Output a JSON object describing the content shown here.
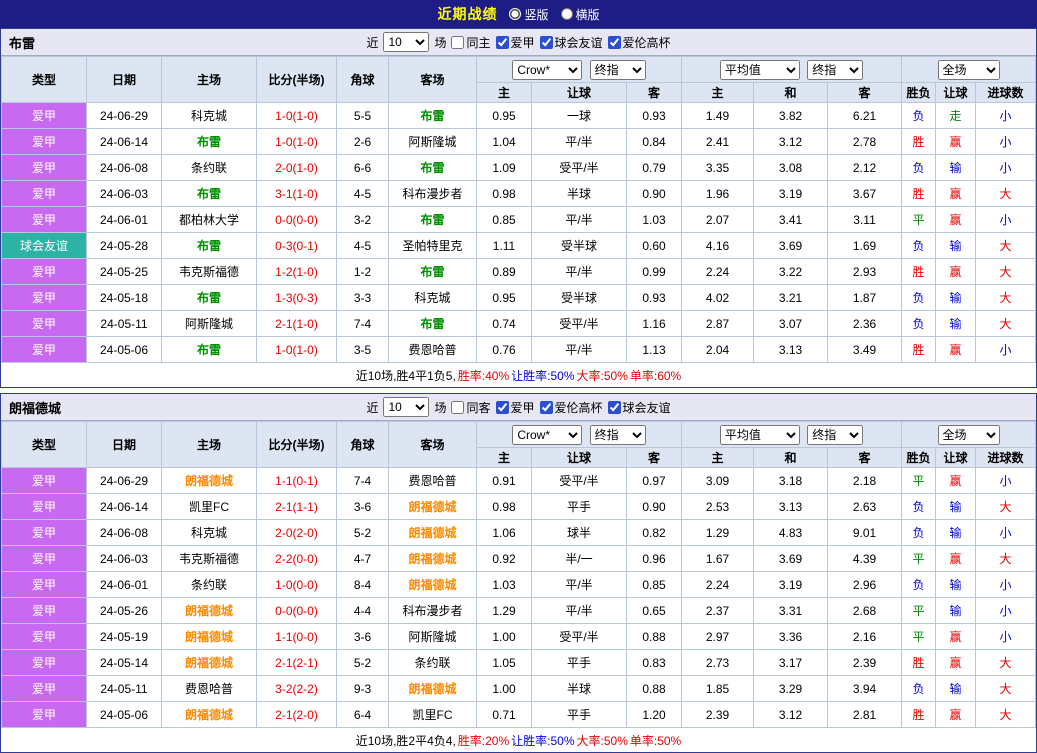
{
  "top_bar": {
    "title": "近期战绩",
    "radios": [
      {
        "label": "竖版",
        "checked": true
      },
      {
        "label": "横版",
        "checked": false
      }
    ]
  },
  "columns": [
    "类型",
    "日期",
    "主场",
    "比分(半场)",
    "角球",
    "客场",
    "主",
    "让球",
    "客",
    "主",
    "和",
    "客",
    "胜负",
    "让球",
    "进球数"
  ],
  "sections": [
    {
      "team": "布雷",
      "hl": "hl-green",
      "near_label": "近",
      "count": "10",
      "games_label": "场",
      "checkboxes": [
        {
          "label": "同主",
          "checked": false
        },
        {
          "label": "爱甲",
          "checked": true
        },
        {
          "label": "球会友谊",
          "checked": true
        },
        {
          "label": "爱伦高杯",
          "checked": true
        }
      ],
      "selects": {
        "company": "Crow*",
        "company_stage": "终指",
        "avg": "平均值",
        "avg_stage": "终指",
        "scope": "全场"
      },
      "rows": [
        {
          "type": "爱甲",
          "type_c": "purple",
          "date": "24-06-29",
          "home": "科克城",
          "home_hl": false,
          "score": "1-0(1-0)",
          "corner": "5-5",
          "away": "布雷",
          "away_hl": true,
          "o_h": "0.95",
          "line": "一球",
          "o_a": "0.93",
          "e_h": "1.49",
          "e_d": "3.82",
          "e_a": "6.21",
          "res": "负",
          "res_c": "blue",
          "hres": "走",
          "hres_c": "green",
          "gres": "小",
          "gres_c": "blue"
        },
        {
          "type": "爱甲",
          "type_c": "purple",
          "date": "24-06-14",
          "home": "布雷",
          "home_hl": true,
          "score": "1-0(1-0)",
          "corner": "2-6",
          "away": "阿斯隆城",
          "away_hl": false,
          "o_h": "1.04",
          "line": "平/半",
          "o_a": "0.84",
          "e_h": "2.41",
          "e_d": "3.12",
          "e_a": "2.78",
          "res": "胜",
          "res_c": "red",
          "hres": "赢",
          "hres_c": "red",
          "gres": "小",
          "gres_c": "blue"
        },
        {
          "type": "爱甲",
          "type_c": "purple",
          "date": "24-06-08",
          "home": "条约联",
          "home_hl": false,
          "score": "2-0(1-0)",
          "corner": "6-6",
          "away": "布雷",
          "away_hl": true,
          "o_h": "1.09",
          "line": "受平/半",
          "o_a": "0.79",
          "e_h": "3.35",
          "e_d": "3.08",
          "e_a": "2.12",
          "res": "负",
          "res_c": "blue",
          "hres": "输",
          "hres_c": "blue",
          "gres": "小",
          "gres_c": "blue"
        },
        {
          "type": "爱甲",
          "type_c": "purple",
          "date": "24-06-03",
          "home": "布雷",
          "home_hl": true,
          "score": "3-1(1-0)",
          "corner": "4-5",
          "away": "科布漫步者",
          "away_hl": false,
          "o_h": "0.98",
          "line": "半球",
          "o_a": "0.90",
          "e_h": "1.96",
          "e_d": "3.19",
          "e_a": "3.67",
          "res": "胜",
          "res_c": "red",
          "hres": "赢",
          "hres_c": "red",
          "gres": "大",
          "gres_c": "red"
        },
        {
          "type": "爱甲",
          "type_c": "purple",
          "date": "24-06-01",
          "home": "都柏林大学",
          "home_hl": false,
          "score": "0-0(0-0)",
          "corner": "3-2",
          "away": "布雷",
          "away_hl": true,
          "o_h": "0.85",
          "line": "平/半",
          "o_a": "1.03",
          "e_h": "2.07",
          "e_d": "3.41",
          "e_a": "3.11",
          "res": "平",
          "res_c": "green",
          "hres": "赢",
          "hres_c": "red",
          "gres": "小",
          "gres_c": "blue"
        },
        {
          "type": "球会友谊",
          "type_c": "teal",
          "date": "24-05-28",
          "home": "布雷",
          "home_hl": true,
          "score": "0-3(0-1)",
          "corner": "4-5",
          "away": "圣帕特里克",
          "away_hl": false,
          "o_h": "1.11",
          "line": "受半球",
          "o_a": "0.60",
          "e_h": "4.16",
          "e_d": "3.69",
          "e_a": "1.69",
          "res": "负",
          "res_c": "blue",
          "hres": "输",
          "hres_c": "blue",
          "gres": "大",
          "gres_c": "red"
        },
        {
          "type": "爱甲",
          "type_c": "purple",
          "date": "24-05-25",
          "home": "韦克斯福德",
          "home_hl": false,
          "score": "1-2(1-0)",
          "corner": "1-2",
          "away": "布雷",
          "away_hl": true,
          "o_h": "0.89",
          "line": "平/半",
          "o_a": "0.99",
          "e_h": "2.24",
          "e_d": "3.22",
          "e_a": "2.93",
          "res": "胜",
          "res_c": "red",
          "hres": "赢",
          "hres_c": "red",
          "gres": "大",
          "gres_c": "red"
        },
        {
          "type": "爱甲",
          "type_c": "purple",
          "date": "24-05-18",
          "home": "布雷",
          "home_hl": true,
          "score": "1-3(0-3)",
          "corner": "3-3",
          "away": "科克城",
          "away_hl": false,
          "o_h": "0.95",
          "line": "受半球",
          "o_a": "0.93",
          "e_h": "4.02",
          "e_d": "3.21",
          "e_a": "1.87",
          "res": "负",
          "res_c": "blue",
          "hres": "输",
          "hres_c": "blue",
          "gres": "大",
          "gres_c": "red"
        },
        {
          "type": "爱甲",
          "type_c": "purple",
          "date": "24-05-11",
          "home": "阿斯隆城",
          "home_hl": false,
          "score": "2-1(1-0)",
          "corner": "7-4",
          "away": "布雷",
          "away_hl": true,
          "o_h": "0.74",
          "line": "受平/半",
          "o_a": "1.16",
          "e_h": "2.87",
          "e_d": "3.07",
          "e_a": "2.36",
          "res": "负",
          "res_c": "blue",
          "hres": "输",
          "hres_c": "blue",
          "gres": "大",
          "gres_c": "red"
        },
        {
          "type": "爱甲",
          "type_c": "purple",
          "date": "24-05-06",
          "home": "布雷",
          "home_hl": true,
          "score": "1-0(1-0)",
          "corner": "3-5",
          "away": "费恩哈普",
          "away_hl": false,
          "o_h": "0.76",
          "line": "平/半",
          "o_a": "1.13",
          "e_h": "2.04",
          "e_d": "3.13",
          "e_a": "3.49",
          "res": "胜",
          "res_c": "red",
          "hres": "赢",
          "hres_c": "red",
          "gres": "小",
          "gres_c": "blue"
        }
      ],
      "summary": [
        {
          "text": "近10场,胜4平1负5, ",
          "c": "black"
        },
        {
          "text": "胜率:40%",
          "c": "red"
        },
        {
          "text": " 让胜率:50%",
          "c": "blue"
        },
        {
          "text": " 大率:50%",
          "c": "red"
        },
        {
          "text": " 单率:60%",
          "c": "red"
        }
      ]
    },
    {
      "team": "朗福德城",
      "hl": "hl-orange",
      "near_label": "近",
      "count": "10",
      "games_label": "场",
      "checkboxes": [
        {
          "label": "同客",
          "checked": false
        },
        {
          "label": "爱甲",
          "checked": true
        },
        {
          "label": "爱伦高杯",
          "checked": true
        },
        {
          "label": "球会友谊",
          "checked": true
        }
      ],
      "selects": {
        "company": "Crow*",
        "company_stage": "终指",
        "avg": "平均值",
        "avg_stage": "终指",
        "scope": "全场"
      },
      "rows": [
        {
          "type": "爱甲",
          "type_c": "purple",
          "date": "24-06-29",
          "home": "朗福德城",
          "home_hl": true,
          "score": "1-1(0-1)",
          "corner": "7-4",
          "away": "费恩哈普",
          "away_hl": false,
          "o_h": "0.91",
          "line": "受平/半",
          "o_a": "0.97",
          "e_h": "3.09",
          "e_d": "3.18",
          "e_a": "2.18",
          "res": "平",
          "res_c": "green",
          "hres": "赢",
          "hres_c": "red",
          "gres": "小",
          "gres_c": "blue"
        },
        {
          "type": "爱甲",
          "type_c": "purple",
          "date": "24-06-14",
          "home": "凯里FC",
          "home_hl": false,
          "score": "2-1(1-1)",
          "corner": "3-6",
          "away": "朗福德城",
          "away_hl": true,
          "o_h": "0.98",
          "line": "平手",
          "o_a": "0.90",
          "e_h": "2.53",
          "e_d": "3.13",
          "e_a": "2.63",
          "res": "负",
          "res_c": "blue",
          "hres": "输",
          "hres_c": "blue",
          "gres": "大",
          "gres_c": "red"
        },
        {
          "type": "爱甲",
          "type_c": "purple",
          "date": "24-06-08",
          "home": "科克城",
          "home_hl": false,
          "score": "2-0(2-0)",
          "corner": "5-2",
          "away": "朗福德城",
          "away_hl": true,
          "o_h": "1.06",
          "line": "球半",
          "o_a": "0.82",
          "e_h": "1.29",
          "e_d": "4.83",
          "e_a": "9.01",
          "res": "负",
          "res_c": "blue",
          "hres": "输",
          "hres_c": "blue",
          "gres": "小",
          "gres_c": "blue"
        },
        {
          "type": "爱甲",
          "type_c": "purple",
          "date": "24-06-03",
          "home": "韦克斯福德",
          "home_hl": false,
          "score": "2-2(0-0)",
          "corner": "4-7",
          "away": "朗福德城",
          "away_hl": true,
          "o_h": "0.92",
          "line": "半/一",
          "o_a": "0.96",
          "e_h": "1.67",
          "e_d": "3.69",
          "e_a": "4.39",
          "res": "平",
          "res_c": "green",
          "hres": "赢",
          "hres_c": "red",
          "gres": "大",
          "gres_c": "red"
        },
        {
          "type": "爱甲",
          "type_c": "purple",
          "date": "24-06-01",
          "home": "条约联",
          "home_hl": false,
          "score": "1-0(0-0)",
          "corner": "8-4",
          "away": "朗福德城",
          "away_hl": true,
          "o_h": "1.03",
          "line": "平/半",
          "o_a": "0.85",
          "e_h": "2.24",
          "e_d": "3.19",
          "e_a": "2.96",
          "res": "负",
          "res_c": "blue",
          "hres": "输",
          "hres_c": "blue",
          "gres": "小",
          "gres_c": "blue"
        },
        {
          "type": "爱甲",
          "type_c": "purple",
          "date": "24-05-26",
          "home": "朗福德城",
          "home_hl": true,
          "score": "0-0(0-0)",
          "corner": "4-4",
          "away": "科布漫步者",
          "away_hl": false,
          "o_h": "1.29",
          "line": "平/半",
          "o_a": "0.65",
          "e_h": "2.37",
          "e_d": "3.31",
          "e_a": "2.68",
          "res": "平",
          "res_c": "green",
          "hres": "输",
          "hres_c": "blue",
          "gres": "小",
          "gres_c": "blue"
        },
        {
          "type": "爱甲",
          "type_c": "purple",
          "date": "24-05-19",
          "home": "朗福德城",
          "home_hl": true,
          "score": "1-1(0-0)",
          "corner": "3-6",
          "away": "阿斯隆城",
          "away_hl": false,
          "o_h": "1.00",
          "line": "受平/半",
          "o_a": "0.88",
          "e_h": "2.97",
          "e_d": "3.36",
          "e_a": "2.16",
          "res": "平",
          "res_c": "green",
          "hres": "赢",
          "hres_c": "red",
          "gres": "小",
          "gres_c": "blue"
        },
        {
          "type": "爱甲",
          "type_c": "purple",
          "date": "24-05-14",
          "home": "朗福德城",
          "home_hl": true,
          "score": "2-1(2-1)",
          "corner": "5-2",
          "away": "条约联",
          "away_hl": false,
          "o_h": "1.05",
          "line": "平手",
          "o_a": "0.83",
          "e_h": "2.73",
          "e_d": "3.17",
          "e_a": "2.39",
          "res": "胜",
          "res_c": "red",
          "hres": "赢",
          "hres_c": "red",
          "gres": "大",
          "gres_c": "red"
        },
        {
          "type": "爱甲",
          "type_c": "purple",
          "date": "24-05-11",
          "home": "费恩哈普",
          "home_hl": false,
          "score": "3-2(2-2)",
          "corner": "9-3",
          "away": "朗福德城",
          "away_hl": true,
          "o_h": "1.00",
          "line": "半球",
          "o_a": "0.88",
          "e_h": "1.85",
          "e_d": "3.29",
          "e_a": "3.94",
          "res": "负",
          "res_c": "blue",
          "hres": "输",
          "hres_c": "blue",
          "gres": "大",
          "gres_c": "red"
        },
        {
          "type": "爱甲",
          "type_c": "purple",
          "date": "24-05-06",
          "home": "朗福德城",
          "home_hl": true,
          "score": "2-1(2-0)",
          "corner": "6-4",
          "away": "凯里FC",
          "away_hl": false,
          "o_h": "0.71",
          "line": "平手",
          "o_a": "1.20",
          "e_h": "2.39",
          "e_d": "3.12",
          "e_a": "2.81",
          "res": "胜",
          "res_c": "red",
          "hres": "赢",
          "hres_c": "red",
          "gres": "大",
          "gres_c": "red"
        }
      ],
      "summary": [
        {
          "text": "近10场,胜2平4负4, ",
          "c": "black"
        },
        {
          "text": "胜率:20%",
          "c": "red"
        },
        {
          "text": " 让胜率:50%",
          "c": "blue"
        },
        {
          "text": " 大率:50%",
          "c": "red"
        },
        {
          "text": " 单率:50%",
          "c": "red"
        }
      ]
    }
  ]
}
